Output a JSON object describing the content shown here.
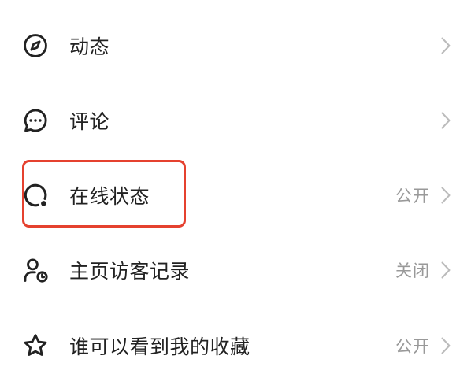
{
  "settings": {
    "items": [
      {
        "label": "动态",
        "icon": "compass-icon",
        "chevron": "chevron-right-icon"
      },
      {
        "label": "评论",
        "icon": "chat-bubble-icon",
        "chevron": "chevron-right-icon"
      },
      {
        "label": "在线状态",
        "value": "公开",
        "icon": "online-status-icon",
        "chevron": "chevron-right-icon",
        "highlighted": true
      },
      {
        "label": "主页访客记录",
        "value": "关闭",
        "icon": "visitor-clock-icon",
        "chevron": "chevron-right-icon"
      },
      {
        "label": "谁可以看到我的收藏",
        "value": "公开",
        "icon": "star-icon",
        "chevron": "chevron-right-icon"
      }
    ]
  },
  "colors": {
    "text": "#222222",
    "value": "#999999",
    "chevron": "#bbbbbb",
    "highlight": "#e5412f",
    "background": "#ffffff"
  }
}
